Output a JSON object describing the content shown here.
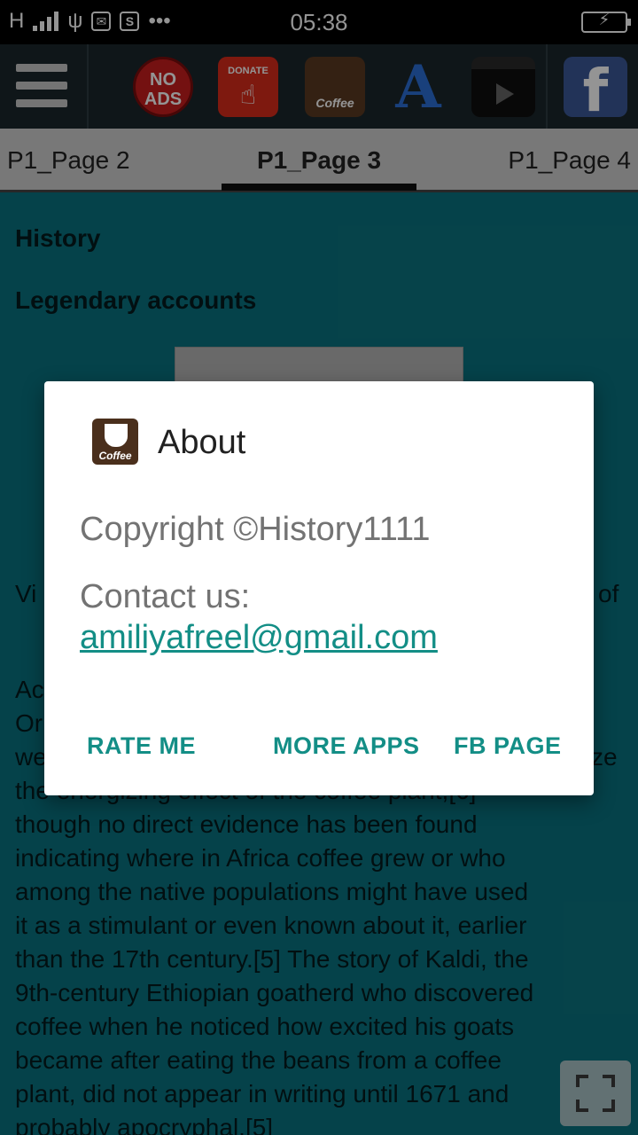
{
  "status_bar": {
    "network": "H",
    "time": "05:38",
    "battery_symbol": "⚡"
  },
  "toolbar": {
    "no_ads_line1": "NO",
    "no_ads_line2": "ADS",
    "donate_label": "DONATE",
    "coffee_label": "Coffee",
    "font_glyph": "A",
    "facebook_glyph": "f"
  },
  "tabs": [
    {
      "label": "P1_Page 2"
    },
    {
      "label": "P1_Page 3",
      "selected": true
    },
    {
      "label": "P1_Page 4"
    }
  ],
  "content": {
    "heading1": "History",
    "heading2": "Legendary accounts",
    "frag_vi": "Vi",
    "frag_of": "of",
    "frag_ac": "Ac",
    "frag_or": "Or",
    "frag_we": "we",
    "frag_ze": "ze",
    "frag_the": "the energizing effect of the coffee plant,[6]",
    "paragraph_lines": [
      "though no direct evidence has been found",
      "indicating where in Africa coffee grew or who",
      "among the native populations might have used",
      "it as a stimulant or even known about it, earlier",
      "than the 17th century.[5] The story of Kaldi, the",
      "9th-century Ethiopian goatherd who discovered",
      "coffee when he noticed how excited his goats",
      "became after eating the beans from a coffee",
      "plant, did not appear in writing until 1671 and",
      "probably apocryphal.[5]"
    ]
  },
  "dialog": {
    "title": "About",
    "icon_label": "Coffee",
    "copyright": "Copyright ©History1111",
    "contact_label": "Contact us:",
    "email": "amiliyafreel@gmail.com",
    "buttons": {
      "rate": "RATE ME",
      "more_apps": "MORE APPS",
      "fb_page": "FB PAGE"
    }
  },
  "colors": {
    "content_bg": "#0a7380",
    "accent": "#138e86",
    "toolbar_bg": "#1b262c"
  }
}
